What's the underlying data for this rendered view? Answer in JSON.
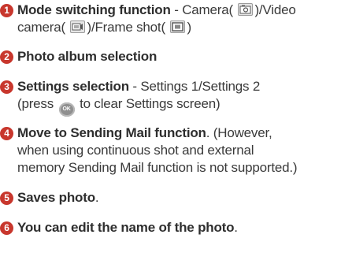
{
  "items": [
    {
      "number": "1",
      "title": "Mode switching function",
      "sep": " - ",
      "line1_pre": "Camera(",
      "line1_post": ")/Video",
      "line2_a": "camera(",
      "line2_b": ")/Frame shot(",
      "line2_c": ")",
      "icons": [
        "camera-icon",
        "video-camera-icon",
        "frame-shot-icon"
      ]
    },
    {
      "number": "2",
      "title": "Photo album selection"
    },
    {
      "number": "3",
      "title": "Settings selection",
      "sep": " - ",
      "line1_rest": "Settings 1/Settings 2",
      "line2_pre": "(press",
      "ok_label": "OK",
      "line2_post": "to clear Settings screen)"
    },
    {
      "number": "4",
      "title": "Move to Sending Mail function",
      "line1_rest": ". (However,",
      "line2": "when using continuous shot and external",
      "line3": "memory Sending Mail function is not supported.)"
    },
    {
      "number": "5",
      "title": "Saves photo",
      "line1_rest": "."
    },
    {
      "number": "6",
      "title": "You can edit the name of the photo",
      "line1_rest": "."
    }
  ],
  "colors": {
    "number_badge": "#c8372d",
    "text": "#3a3a3a"
  }
}
